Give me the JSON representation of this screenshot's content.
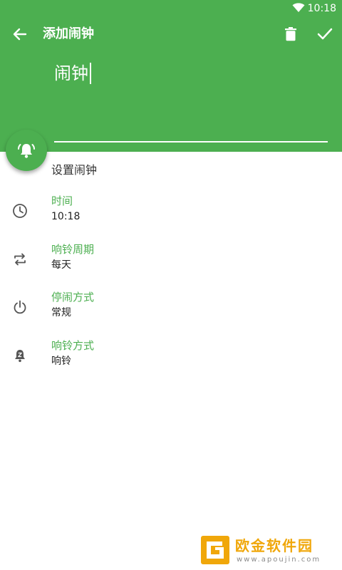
{
  "status_bar": {
    "time": "10:18"
  },
  "toolbar": {
    "title": "添加闹钟"
  },
  "alarm_name": {
    "value": "闹钟"
  },
  "section_title": "设置闹钟",
  "settings": [
    {
      "label": "时间",
      "value": "10:18",
      "icon": "clock-icon"
    },
    {
      "label": "响铃周期",
      "value": "每天",
      "icon": "repeat-icon"
    },
    {
      "label": "停闹方式",
      "value": "常规",
      "icon": "power-icon"
    },
    {
      "label": "响铃方式",
      "value": "响铃",
      "icon": "ring-mode-icon"
    }
  ],
  "watermark": {
    "name": "欧金软件园",
    "url": "www.apoujin.com"
  },
  "colors": {
    "accent": "#4caf50",
    "watermark": "#f0a70a"
  }
}
